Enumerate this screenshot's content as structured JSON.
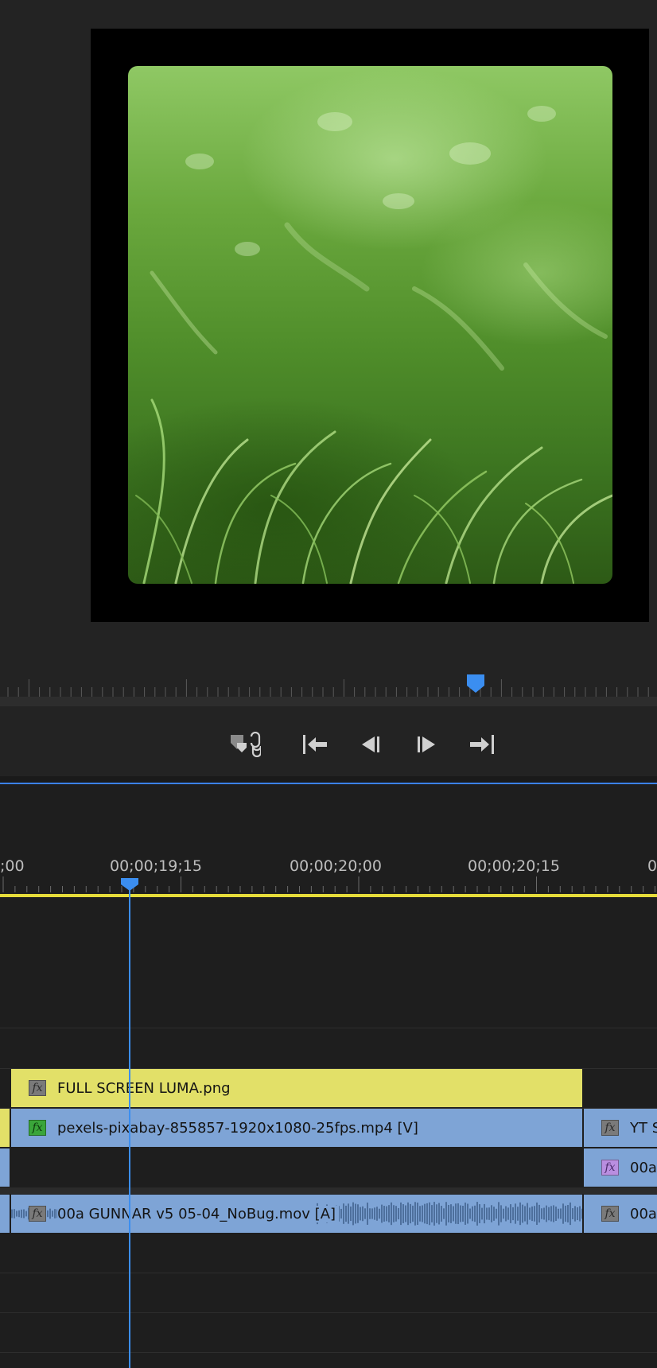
{
  "colors": {
    "panel_bg": "#232323",
    "timeline_bg": "#1e1e1e",
    "playhead": "#3b8ef0",
    "work_area": "#e6dc3a",
    "clip_yellow": "#e2e068",
    "clip_blue": "#7ea4d6"
  },
  "transport": {
    "buttons": [
      {
        "icon": "add-marker-link-icon"
      },
      {
        "icon": "go-to-in-icon"
      },
      {
        "icon": "step-back-icon"
      },
      {
        "icon": "step-forward-icon"
      },
      {
        "icon": "go-to-out-icon"
      }
    ]
  },
  "timeline": {
    "timecodes": [
      ";00",
      "00;00;19;15",
      "00;00;20;00",
      "00;00;20;15",
      "0"
    ],
    "clips": {
      "v3_luma": {
        "name": "FULL SCREEN LUMA.png"
      },
      "v2_pexels": {
        "name": "pexels-pixabay-855857-1920x1080-25fps.mp4 [V]"
      },
      "v2_right": {
        "name": "YT S"
      },
      "v1_right": {
        "name": "00a"
      },
      "a1_main": {
        "name": "00a GUNNAR v5 05-04_NoBug.mov [A]"
      },
      "a1_right": {
        "name": "00a"
      }
    }
  }
}
